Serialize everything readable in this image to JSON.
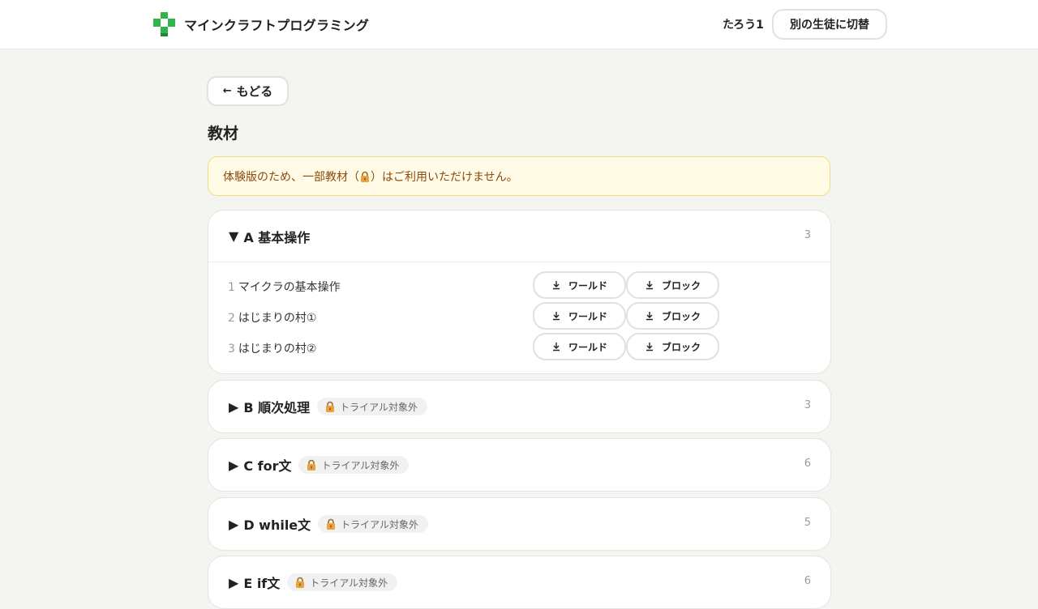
{
  "header": {
    "brand": "マインクラフトプログラミング",
    "user": "たろう1",
    "switch_label": "別の生徒に切替"
  },
  "back_label": "もどる",
  "page_title": "教材",
  "notice": {
    "before": "体験版のため、一部教材（",
    "after": "）はご利用いただけません。"
  },
  "download_labels": {
    "world": "ワールド",
    "block": "ブロック"
  },
  "sections": [
    {
      "toggle": "▼",
      "title": "A 基本操作",
      "count": "3",
      "expanded": true,
      "lessons": [
        {
          "num": "1",
          "title": "マイクラの基本操作"
        },
        {
          "num": "2",
          "title": "はじまりの村①"
        },
        {
          "num": "3",
          "title": "はじまりの村②"
        }
      ]
    },
    {
      "toggle": "▶",
      "title": "B 順次処理",
      "badge": "トライアル対象外",
      "count": "3",
      "expanded": false
    },
    {
      "toggle": "▶",
      "title": "C for文",
      "badge": "トライアル対象外",
      "count": "6",
      "expanded": false
    },
    {
      "toggle": "▶",
      "title": "D while文",
      "badge": "トライアル対象外",
      "count": "5",
      "expanded": false
    },
    {
      "toggle": "▶",
      "title": "E if文",
      "badge": "トライアル対象外",
      "count": "6",
      "expanded": false
    }
  ],
  "colors": {
    "background": "#f4f4f0",
    "brand_green": "#2fb54a",
    "notice_bg": "#fffbe6",
    "notice_text": "#8a4a0c",
    "lock": "#e8a33c"
  },
  "icons": {
    "logo": "green-plus-logo-icon",
    "back": "arrow-left-icon",
    "lock": "lock-icon",
    "download": "download-icon"
  }
}
